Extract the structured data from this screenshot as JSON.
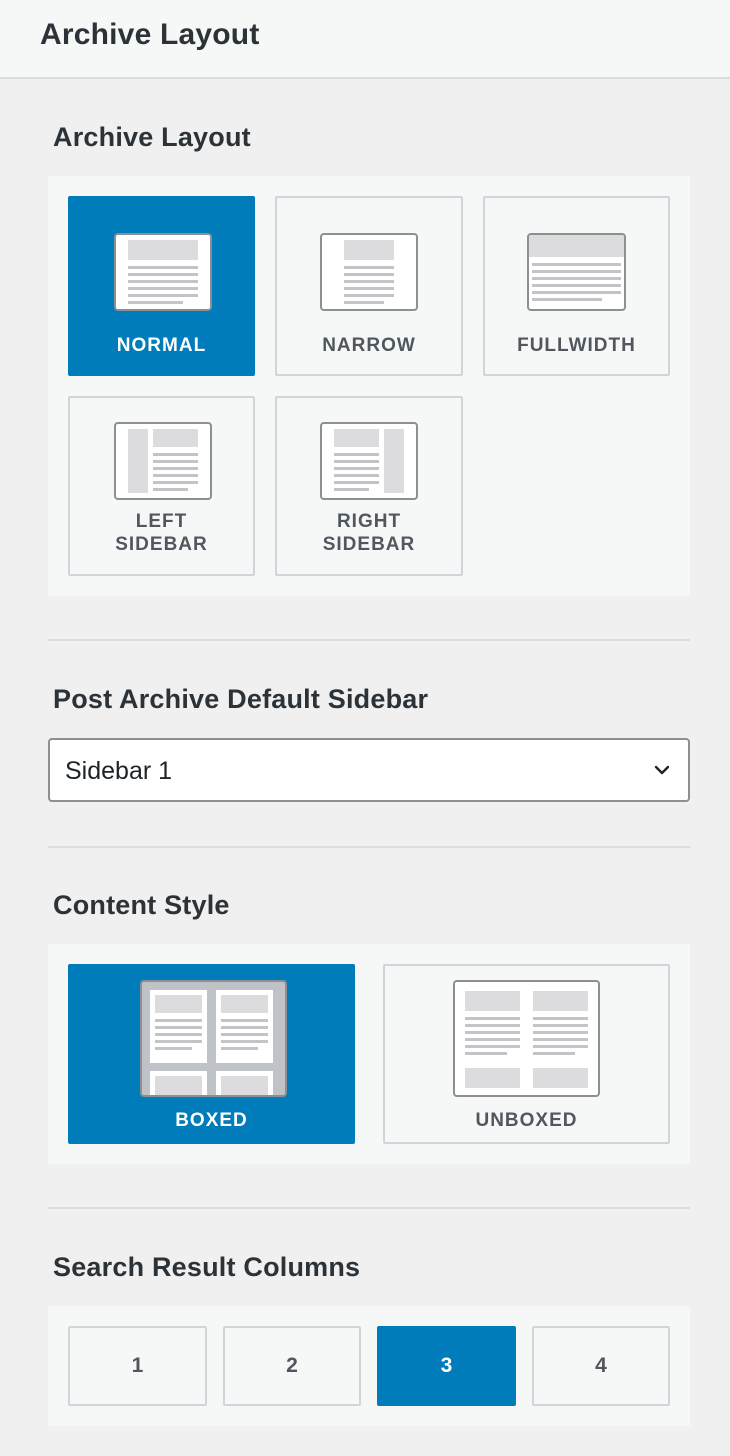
{
  "panel": {
    "title": "Archive Layout"
  },
  "archive_layout": {
    "title": "Archive Layout",
    "options": [
      {
        "label": "NORMAL",
        "selected": true
      },
      {
        "label": "NARROW",
        "selected": false
      },
      {
        "label": "FULLWIDTH",
        "selected": false
      },
      {
        "label": "LEFT SIDEBAR",
        "line1": "LEFT",
        "line2": "SIDEBAR",
        "selected": false
      },
      {
        "label": "RIGHT SIDEBAR",
        "line1": "RIGHT",
        "line2": "SIDEBAR",
        "selected": false
      }
    ]
  },
  "default_sidebar": {
    "title": "Post Archive Default Sidebar",
    "value": "Sidebar 1"
  },
  "content_style": {
    "title": "Content Style",
    "options": [
      {
        "label": "BOXED",
        "selected": true
      },
      {
        "label": "UNBOXED",
        "selected": false
      }
    ]
  },
  "search_columns": {
    "title": "Search Result Columns",
    "options": [
      "1",
      "2",
      "3",
      "4"
    ],
    "selected": "3"
  },
  "colors": {
    "accent": "#007cba",
    "background": "#f0f0f1",
    "option_border": "#d0d5db"
  }
}
